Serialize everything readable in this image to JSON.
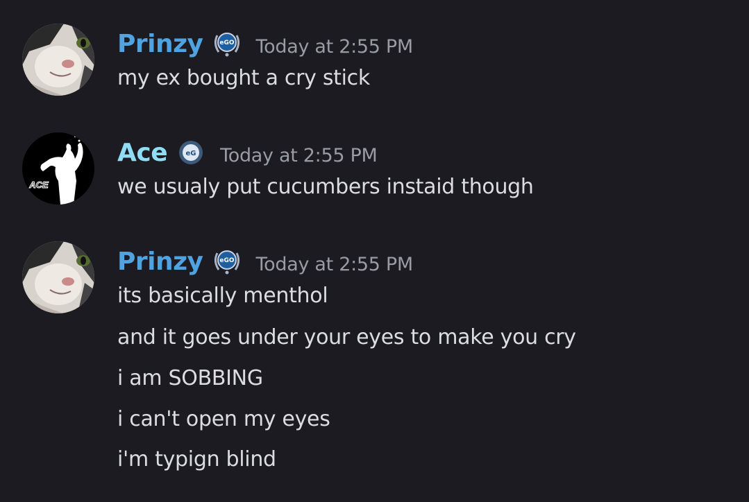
{
  "messages": [
    {
      "author": "Prinzy",
      "author_color": "#4fa3e0",
      "badge_icon": "ego-laurel-badge-icon",
      "badge_text": "eGO",
      "timestamp": "Today at 2:55 PM",
      "avatar_icon": "cat-avatar",
      "lines": [
        "my ex bought a cry stick"
      ]
    },
    {
      "author": "Ace",
      "author_color": "#8fdcf5",
      "badge_icon": "eg-round-badge-icon",
      "badge_text": "eG",
      "timestamp": "Today at 2:55 PM",
      "avatar_icon": "ace-silhouette-avatar",
      "avatar_text": "ACE",
      "lines": [
        "we usualy put cucumbers instaid though"
      ]
    },
    {
      "author": "Prinzy",
      "author_color": "#4fa3e0",
      "badge_icon": "ego-laurel-badge-icon",
      "badge_text": "eGO",
      "timestamp": "Today at 2:55 PM",
      "avatar_icon": "cat-avatar",
      "lines": [
        "its basically menthol",
        "and it goes under your eyes to make you cry",
        "i am SOBBING",
        "i can't open my eyes",
        "i'm typign blind"
      ]
    }
  ]
}
